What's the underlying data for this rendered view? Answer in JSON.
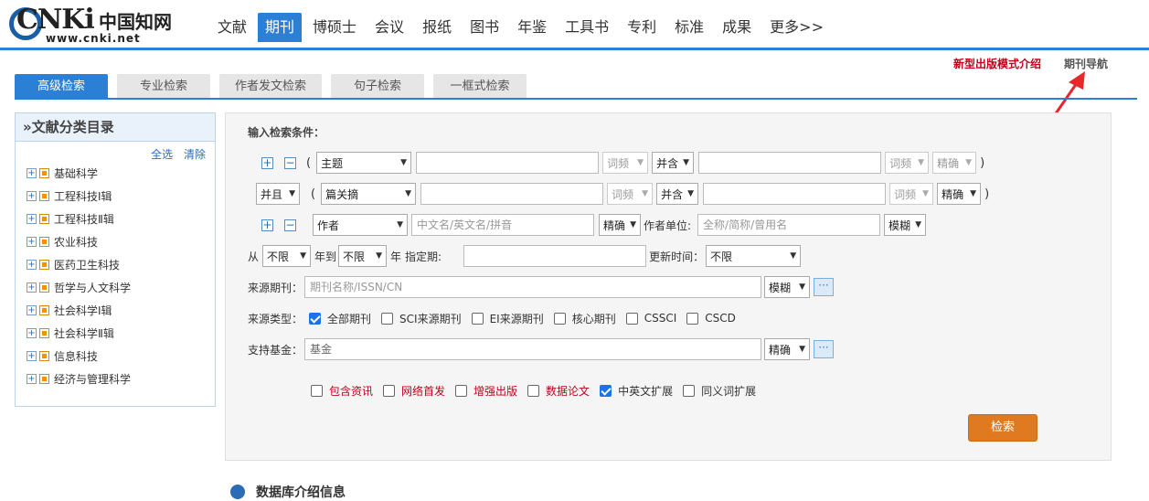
{
  "logo": {
    "brand": "CNKi",
    "name": "中国知网",
    "url": "www.cnki.net"
  },
  "nav": {
    "items": [
      "文献",
      "期刊",
      "博硕士",
      "会议",
      "报纸",
      "图书",
      "年鉴",
      "工具书",
      "专利",
      "标准",
      "成果",
      "更多>>"
    ],
    "active": "期刊"
  },
  "links": {
    "promo": "新型出版模式介绍",
    "journal_nav": "期刊导航"
  },
  "tabs": [
    "高级检索",
    "专业检索",
    "作者发文检索",
    "句子检索",
    "一框式检索"
  ],
  "sidebar": {
    "title": "»文献分类目录",
    "select_all": "全选",
    "clear": "清除",
    "categories": [
      "基础科学",
      "工程科技Ⅰ辑",
      "工程科技Ⅱ辑",
      "农业科技",
      "医药卫生科技",
      "哲学与人文科学",
      "社会科学Ⅰ辑",
      "社会科学Ⅱ辑",
      "信息科技",
      "经济与管理科学"
    ]
  },
  "form": {
    "title": "输入检索条件：",
    "row1": {
      "field": "主题",
      "freq1": "词频",
      "logic": "并含",
      "freq2": "词频",
      "match": "精确"
    },
    "row2": {
      "bool": "并且",
      "field": "篇关摘",
      "freq1": "词频",
      "logic": "并含",
      "freq2": "词频",
      "match": "精确"
    },
    "row3": {
      "field": "作者",
      "author_placeholder": "中文名/英文名/拼音",
      "match": "精确",
      "unit_label": "作者单位:",
      "unit_placeholder": "全称/简称/曾用名",
      "unit_match": "模糊"
    },
    "row4": {
      "from": "从",
      "year_from": "不限",
      "year_to_label": "年到",
      "year_to": "不限",
      "year_label": "年",
      "period_label": "指定期:",
      "update_label": "更新时间：",
      "update": "不限"
    },
    "row5": {
      "label": "来源期刊：",
      "placeholder": "期刊名称/ISSN/CN",
      "match": "模糊",
      "more": "···"
    },
    "row6": {
      "label": "来源类型：",
      "options": [
        {
          "label": "全部期刊",
          "checked": true
        },
        {
          "label": "SCI来源期刊",
          "checked": false
        },
        {
          "label": "EI来源期刊",
          "checked": false
        },
        {
          "label": "核心期刊",
          "checked": false
        },
        {
          "label": "CSSCI",
          "checked": false
        },
        {
          "label": "CSCD",
          "checked": false
        }
      ]
    },
    "row7": {
      "label": "支持基金：",
      "value": "基金",
      "match": "精确",
      "more": "···"
    },
    "extras": [
      {
        "label": "包含资讯",
        "checked": false,
        "red": true
      },
      {
        "label": "网络首发",
        "checked": false,
        "red": true
      },
      {
        "label": "增强出版",
        "checked": false,
        "red": true
      },
      {
        "label": "数据论文",
        "checked": false,
        "red": true
      },
      {
        "label": "中英文扩展",
        "checked": true,
        "red": false
      },
      {
        "label": "同义词扩展",
        "checked": false,
        "red": false
      }
    ],
    "search_button": "检索"
  },
  "bottom": {
    "text": "数据库介绍信息"
  },
  "colors": {
    "primary": "#2b7fd4",
    "accent_red": "#c0001b",
    "search_orange": "#e07a21"
  }
}
